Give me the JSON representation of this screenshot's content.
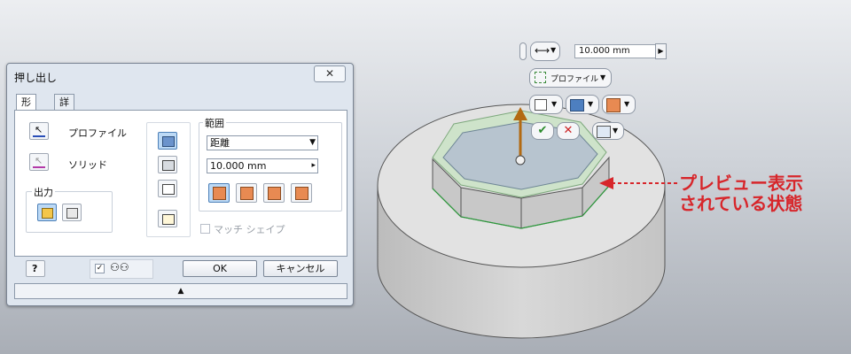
{
  "dialog": {
    "title": "押し出し",
    "close_label": "✕",
    "tabs": [
      {
        "label": "形状",
        "active": true
      },
      {
        "label": "詳細",
        "active": false
      }
    ],
    "profile_label": "プロファイル",
    "solid_label": "ソリッド",
    "output_group_title": "出力",
    "extents": {
      "group_title": "範囲",
      "type_value": "距離",
      "distance_value": "10.000 mm"
    },
    "match_shape_label": "マッチ シェイプ",
    "match_shape_checked": false,
    "preview_checked": true,
    "ok_label": "OK",
    "cancel_label": "キャンセル",
    "help_label": "?",
    "expand_arrow": "▲"
  },
  "minitoolbar": {
    "distance_value": "10.000 mm",
    "profile_label": "プロファイル",
    "ok_symbol": "✔",
    "cancel_symbol": "✕"
  },
  "annotation": {
    "line1": "プレビュー表示",
    "line2": "されている状態",
    "color": "#d7262b"
  },
  "icons": [
    "profile-select-icon",
    "solid-select-icon",
    "output-solid-icon",
    "output-surface-icon",
    "join-icon",
    "cut-icon",
    "intersect-icon",
    "new-solid-icon",
    "direction-default-icon",
    "direction-flip-icon",
    "direction-symmetric-icon",
    "direction-asymmetric-icon",
    "help-icon",
    "glasses-icon",
    "distance-icon",
    "dropdown-arrow-icon"
  ]
}
